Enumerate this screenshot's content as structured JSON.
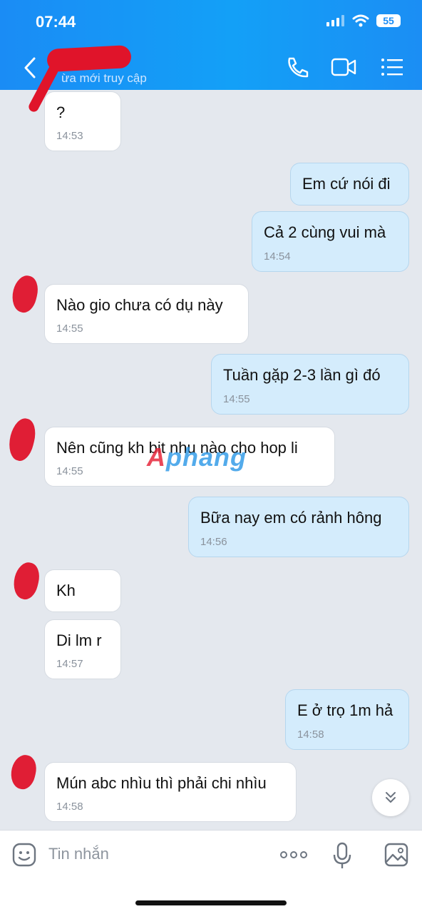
{
  "status_bar": {
    "time": "07:44",
    "battery": "55"
  },
  "header": {
    "status_text": "ừa mới truy cập"
  },
  "messages": [
    {
      "dir": "in",
      "text": "?",
      "time": "14:53"
    },
    {
      "dir": "out",
      "text": "Em cứ nói đi",
      "time": ""
    },
    {
      "dir": "out",
      "text": "Cả 2 cùng vui mà",
      "time": "14:54"
    },
    {
      "dir": "in",
      "text": "Nào gio chưa có dụ này",
      "time": "14:55"
    },
    {
      "dir": "out",
      "text": "Tuần gặp 2-3 lần gì đó",
      "time": "14:55"
    },
    {
      "dir": "in",
      "text": "Nên cũng kh bit nhu nào cho hop li",
      "time": "14:55"
    },
    {
      "dir": "out",
      "text": "Bữa nay em có rảnh hông",
      "time": "14:56"
    },
    {
      "dir": "in",
      "text": "Kh",
      "time": ""
    },
    {
      "dir": "in",
      "text": "Di lm r",
      "time": "14:57"
    },
    {
      "dir": "out",
      "text": "E ở trọ 1m hả",
      "time": "14:58"
    },
    {
      "dir": "in",
      "text": "Mún abc nhìu thì phải chi nhìu",
      "time": "14:58"
    }
  ],
  "watermark": {
    "part1": "A",
    "part2": "phang"
  },
  "composer": {
    "placeholder": "Tin nhắn"
  },
  "icons": {
    "back": "chevron-left-icon",
    "call": "phone-icon",
    "video": "video-camera-icon",
    "menu": "list-menu-icon",
    "sticker": "sticker-face-icon",
    "more": "more-dots-icon",
    "mic": "microphone-icon",
    "image": "image-icon",
    "scroll": "double-chevron-down-icon"
  },
  "colors": {
    "header": "#1a8cf5",
    "outgoing_bubble": "#d4ecfc",
    "incoming_bubble": "#ffffff",
    "redaction": "#e0142a"
  }
}
